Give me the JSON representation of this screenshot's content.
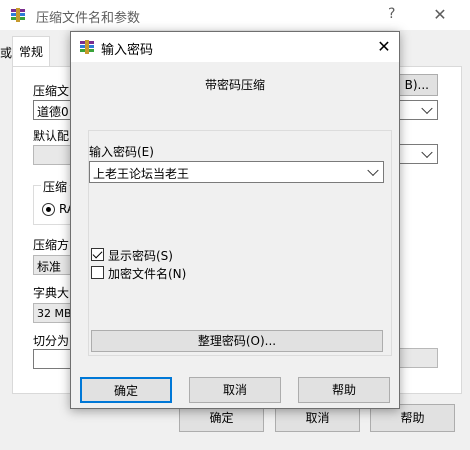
{
  "bg_window": {
    "title": "压缩文件名和参数",
    "help_glyph": "?",
    "close_glyph": "✕",
    "left_edge_char": "或",
    "tab_general": "常规",
    "label_archive_name": "压缩文",
    "archive_name_value": "道德0",
    "browse_button_fragment": "B)...",
    "label_default_profile": "默认配",
    "format_group_label": "压缩",
    "format_radio_label": "RA",
    "label_compress_method": "压缩方",
    "compress_method_value": "标准",
    "label_dict_size": "字典大",
    "dict_size_value": "32 MB",
    "label_split": "切分为",
    "ok": "确定",
    "cancel": "取消",
    "help": "帮助"
  },
  "dialog": {
    "title": "输入密码",
    "close_glyph": "✕",
    "heading": "带密码压缩",
    "password_label": "输入密码(E)",
    "password_value": "上老王论坛当老王",
    "show_password_label": "显示密码(S)",
    "show_password_checked": true,
    "encrypt_filenames_label": "加密文件名(N)",
    "encrypt_filenames_checked": false,
    "organize_button": "整理密码(O)...",
    "ok": "确定",
    "cancel": "取消",
    "help": "帮助"
  },
  "colors": {
    "accent": "#0078d7",
    "window_bg": "#f0f0f0",
    "title_bg": "#ffffff"
  }
}
